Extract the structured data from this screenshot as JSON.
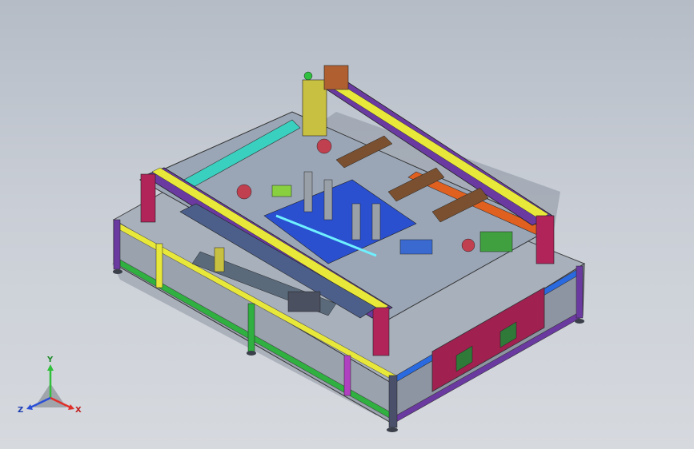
{
  "viewport": {
    "background_top": "#b5bcc6",
    "background_bottom": "#d6d9de"
  },
  "triad": {
    "x_label": "X",
    "y_label": "Y",
    "z_label": "Z",
    "x_color": "#e0302a",
    "y_color": "#2fbf3a",
    "z_color": "#2a4fd6"
  },
  "model": {
    "name": "",
    "accent_colors": [
      "#e8e83a",
      "#6a3aa0",
      "#b0245a",
      "#3ad0c0",
      "#2a6ae0",
      "#e06020",
      "#30b040"
    ]
  }
}
